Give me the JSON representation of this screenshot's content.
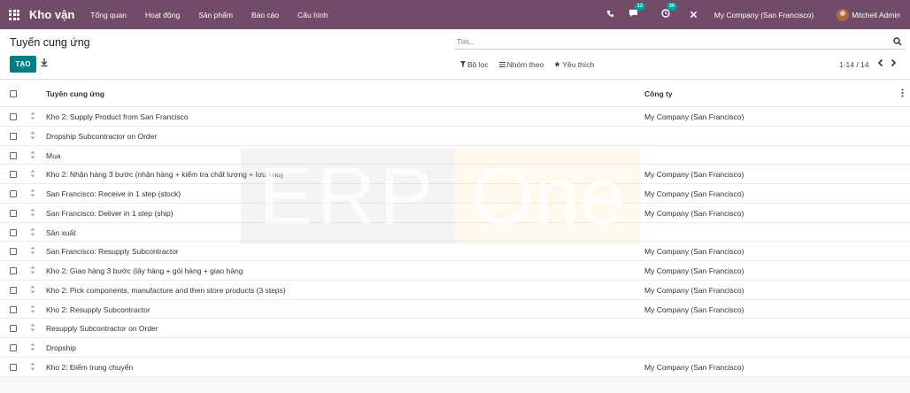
{
  "navbar": {
    "app_name": "Kho vận",
    "menu": [
      "Tổng quan",
      "Hoạt động",
      "Sản phẩm",
      "Báo cáo",
      "Cấu hình"
    ],
    "chat_badge": "13",
    "activity_badge": "30",
    "company": "My Company (San Francisco)",
    "user": "Mitchell Admin"
  },
  "control_panel": {
    "breadcrumb": "Tuyến cung ứng",
    "create_label": "TẠO",
    "search_placeholder": "Tìm...",
    "filters": [
      "Bộ lọc",
      "Nhóm theo",
      "Yêu thích"
    ],
    "pager": "1-14 / 14"
  },
  "list": {
    "columns": [
      "Tuyến cung ứng",
      "Công ty"
    ],
    "rows": [
      {
        "name": "Kho 2: Supply Product from San Francisco",
        "company": "My Company (San Francisco)"
      },
      {
        "name": "Dropship Subcontractor on Order",
        "company": ""
      },
      {
        "name": "Mua",
        "company": ""
      },
      {
        "name": "Kho 2: Nhận hàng 3 bước (nhận hàng + kiểm tra chất lượng + lưu kho)",
        "company": "My Company (San Francisco)"
      },
      {
        "name": "San Francisco: Receive in 1 step (stock)",
        "company": "My Company (San Francisco)"
      },
      {
        "name": "San Francisco: Deliver in 1 step (ship)",
        "company": "My Company (San Francisco)"
      },
      {
        "name": "Sản xuất",
        "company": ""
      },
      {
        "name": "San Francisco: Resupply Subcontractor",
        "company": "My Company (San Francisco)"
      },
      {
        "name": "Kho 2: Giao hàng 3 bước (lấy hàng + gói hàng + giao hàng",
        "company": "My Company (San Francisco)"
      },
      {
        "name": "Kho 2: Pick components, manufacture and then store products (3 steps)",
        "company": "My Company (San Francisco)"
      },
      {
        "name": "Kho 2: Resupply Subcontractor",
        "company": "My Company (San Francisco)"
      },
      {
        "name": "Resupply Subcontractor on Order",
        "company": ""
      },
      {
        "name": "Dropship",
        "company": ""
      },
      {
        "name": "Kho 2: Điểm trung chuyển",
        "company": "My Company (San Francisco)"
      }
    ]
  },
  "watermark": {
    "part1": "ERP",
    "part2": "One"
  },
  "colors": {
    "navbar": "#714b67",
    "primary_button": "#017e84",
    "badge": "#00a09d"
  },
  "icons": [
    "apps-grid-icon",
    "phone-icon",
    "chat-icon",
    "clock-icon",
    "close-icon",
    "download-icon",
    "search-icon",
    "filter-icon",
    "group-by-icon",
    "star-icon",
    "chevron-left-icon",
    "chevron-right-icon",
    "drag-handle-icon",
    "column-options-icon"
  ]
}
